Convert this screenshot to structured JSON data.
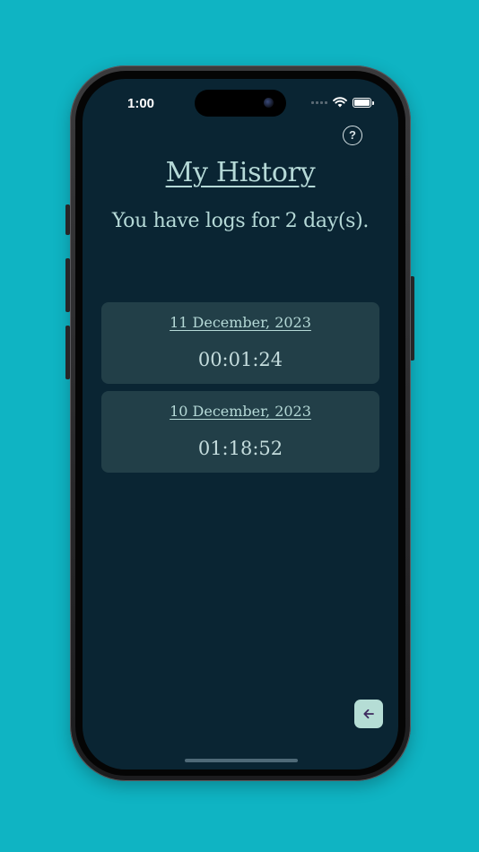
{
  "status_bar": {
    "time": "1:00"
  },
  "header": {
    "title": "My History",
    "subtitle": "You have logs for 2 day(s).",
    "help_icon": "question-circle-icon"
  },
  "logs": [
    {
      "date": "11 December, 2023",
      "duration": "00:01:24"
    },
    {
      "date": "10 December, 2023",
      "duration": "01:18:52"
    }
  ],
  "footer": {
    "back_icon": "arrow-left-icon"
  },
  "colors": {
    "background": "#0fb4c3",
    "screen": "#0a2533",
    "card": "#223f48",
    "text": "#b5d9d7",
    "back_button": "#b5ddd5"
  }
}
